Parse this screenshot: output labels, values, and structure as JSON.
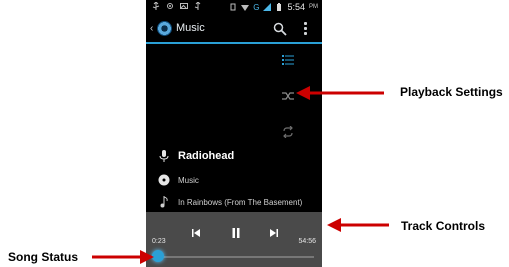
{
  "statusbar": {
    "time": "5:54",
    "ampm": "PM",
    "network": "G"
  },
  "header": {
    "title": "Music"
  },
  "now_playing": {
    "artist": "Radiohead",
    "album": "Music",
    "track": "In Rainbows (From The Basement)"
  },
  "playback": {
    "elapsed": "0:23",
    "total": "54:56",
    "progress_fraction": 0.007
  },
  "callouts": {
    "playback_settings": "Playback Settings",
    "track_controls": "Track Controls",
    "song_status": "Song Status"
  },
  "colors": {
    "accent": "#2aa0d6",
    "arrow": "#cc0000",
    "controls_bg": "#4a4a4a"
  }
}
